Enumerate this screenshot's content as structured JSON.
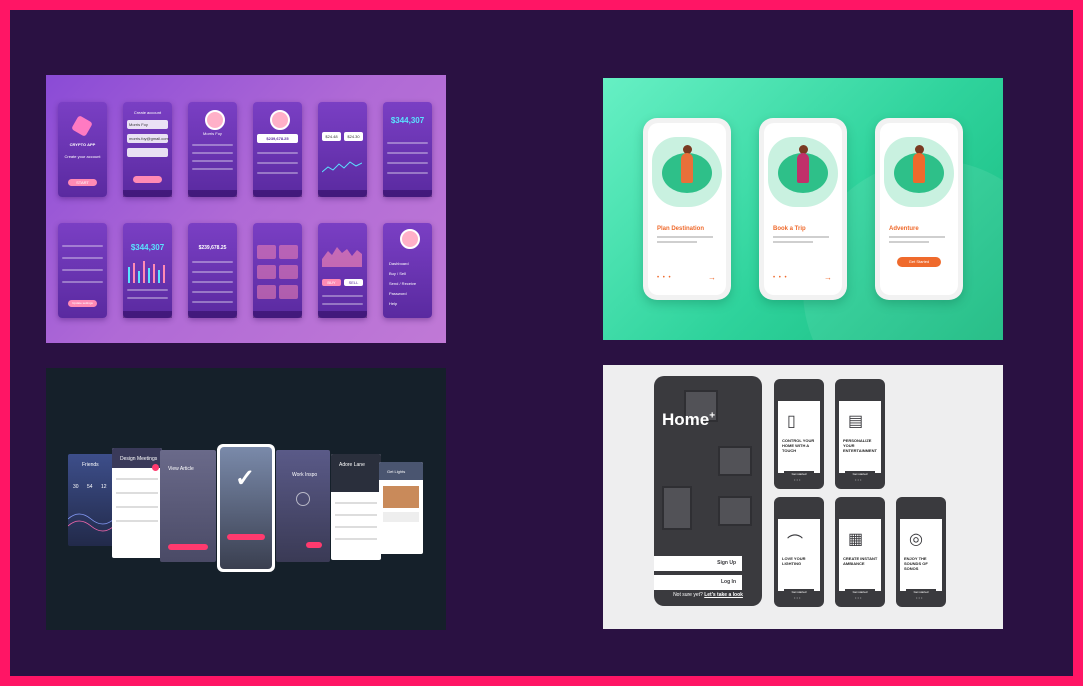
{
  "crypto": {
    "app_title": "CRYPTO APP",
    "create_account": "Create your account",
    "start_button": "START",
    "create_account_screen_title": "Create account",
    "sample_name": "Morris Foy",
    "sample_email": "morris.foy@gmail.com",
    "profile_name": "Morris Foy",
    "balance_big": "$344,307",
    "balance_mid": "$239,678.25",
    "price_a": "$24.48",
    "price_b": "$24.30",
    "balance_mid2": "$239,678.25",
    "balance_big2": "$344,307",
    "buy_label": "BUY",
    "sell_label": "SELL",
    "dashboard": "Dashboard",
    "buy_sell": "Buy / Sell",
    "send_receive": "Send / Receive",
    "password": "Password",
    "help": "Help",
    "update_settings": "Update settings"
  },
  "travel": {
    "screens": [
      {
        "title": "Plan Destination",
        "cta": ""
      },
      {
        "title": "Book a Trip",
        "cta": ""
      },
      {
        "title": "Adventure",
        "cta": "Get Started"
      }
    ],
    "arrow": "→",
    "dots": "• • •"
  },
  "dark": {
    "screens": [
      "Friends",
      "Design Meetings",
      "View Article",
      "",
      "Work Inspo",
      "Adore Lane",
      "Get Lights"
    ],
    "stats": [
      "30",
      "54",
      "12"
    ]
  },
  "home": {
    "title": "Home",
    "title_sup": "+",
    "sign_up": "Sign Up",
    "log_in": "Log In",
    "not_sure": "Not sure yet?",
    "take_look": "Let's take a look",
    "features": [
      {
        "caption": "CONTROL YOUR HOME WITH A TOUCH",
        "icon": "phone-icon",
        "glyph": "▯"
      },
      {
        "caption": "PERSONALIZE YOUR ENTERTAINMENT",
        "icon": "remote-icon",
        "glyph": "▤"
      },
      {
        "caption": "LOVE YOUR LIGHTING",
        "icon": "lamp-icon",
        "glyph": "⌒"
      },
      {
        "caption": "CREATE INSTANT AMBIANCE",
        "icon": "radio-icon",
        "glyph": "▦"
      },
      {
        "caption": "ENJOY THE SOUNDS OF SONOS",
        "icon": "speaker-icon",
        "glyph": "◎"
      }
    ],
    "get_started": "Get started"
  },
  "colors": {
    "border": "#ff1565",
    "background": "#2a1142",
    "crypto_accent": "#5ae3ff",
    "travel_accent": "#ef6a2c",
    "dark_accent": "#ff3a6e"
  }
}
